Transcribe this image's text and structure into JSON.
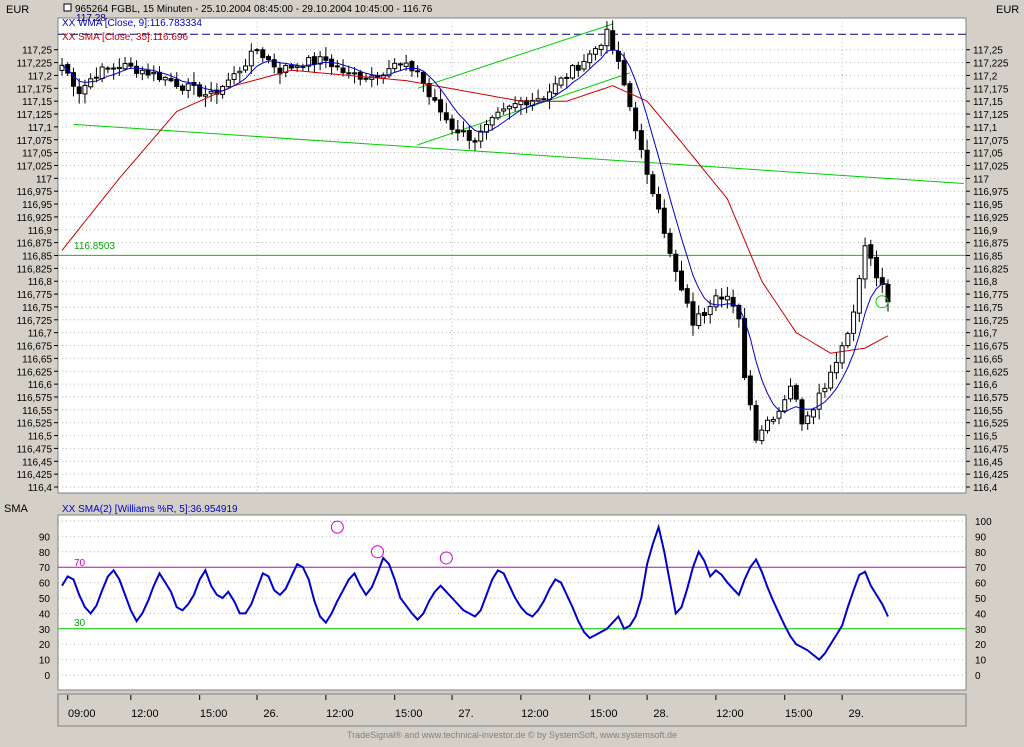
{
  "colors": {
    "background": "#d4d0c8",
    "plot_bg": "#ffffff",
    "candles": "#000000",
    "wma": "#0000cc",
    "sma": "#cc0000",
    "trendlines": "#00cc00",
    "williams": "#0000cc",
    "level70": "#cc00cc",
    "level30": "#00cc00",
    "reference_dash": "#000080",
    "circle": "#cc00cc"
  },
  "header": {
    "currency_left": "EUR",
    "currency_right": "EUR",
    "title": "965264  FGBL, 15 Minuten - 25.10.2004 08:45:00 - 29.10.2004 10:45:00 - 116.76",
    "wma_label": "XX WMA [Close, 9]:116.783334",
    "sma_label": "XX SMA [Close, 35]:116.696",
    "ref_level_label": "117.28",
    "hline_label": "116.8503"
  },
  "indicator": {
    "panel_label": "SMA",
    "series_label": "XX SMA(2) [Williams %R, 5]:36.954919",
    "level70_label": "70",
    "level30_label": "30"
  },
  "footer": {
    "credit": "TradeSignal® and www.technical-investor.de © by SystemSoft, www.systemsoft.de"
  },
  "chart_data": [
    {
      "type": "candlestick",
      "title": "965264  FGBL, 15 Minuten - 25.10.2004 08:45:00 - 29.10.2004 10:45:00 - 116.76",
      "ylabel": "EUR",
      "ylim": [
        116.4,
        117.3
      ],
      "yticks": [
        "117,25",
        "117,225",
        "117,2",
        "117,175",
        "117,15",
        "117,125",
        "117,1",
        "117,075",
        "117,05",
        "117,025",
        "117",
        "116,975",
        "116,95",
        "116,925",
        "116,9",
        "116,875",
        "116,85",
        "116,825",
        "116,8",
        "116,775",
        "116,75",
        "116,725",
        "116,7",
        "116,675",
        "116,65",
        "116,625",
        "116,6",
        "116,575",
        "116,55",
        "116,525",
        "116,5",
        "116,475",
        "116,45",
        "116,425",
        "116,4"
      ],
      "xticks": [
        "09:00",
        "12:00",
        "15:00",
        "26.",
        "12:00",
        "15:00",
        "27.",
        "12:00",
        "15:00",
        "28.",
        "12:00",
        "15:00",
        "29."
      ],
      "bars_per_day": 34,
      "bar_count": 145,
      "last_close": 116.76,
      "close_anchors": [
        [
          0,
          117.22
        ],
        [
          3,
          117.17
        ],
        [
          6,
          117.205
        ],
        [
          10,
          117.22
        ],
        [
          14,
          117.21
        ],
        [
          18,
          117.195
        ],
        [
          22,
          117.175
        ],
        [
          26,
          117.16
        ],
        [
          30,
          117.2
        ],
        [
          34,
          117.25
        ],
        [
          38,
          117.21
        ],
        [
          42,
          117.225
        ],
        [
          46,
          117.23
        ],
        [
          50,
          117.2
        ],
        [
          54,
          117.2
        ],
        [
          58,
          117.22
        ],
        [
          62,
          117.21
        ],
        [
          64,
          117.16
        ],
        [
          68,
          117.1
        ],
        [
          72,
          117.075
        ],
        [
          76,
          117.12
        ],
        [
          80,
          117.15
        ],
        [
          84,
          117.16
        ],
        [
          88,
          117.2
        ],
        [
          92,
          117.24
        ],
        [
          95,
          117.28
        ],
        [
          97,
          117.22
        ],
        [
          100,
          117.1
        ],
        [
          102,
          117.0
        ],
        [
          104,
          116.95
        ],
        [
          106,
          116.85
        ],
        [
          108,
          116.78
        ],
        [
          110,
          116.72
        ],
        [
          112,
          116.74
        ],
        [
          114,
          116.78
        ],
        [
          116,
          116.77
        ],
        [
          118,
          116.72
        ],
        [
          119,
          116.62
        ],
        [
          121,
          116.5
        ],
        [
          123,
          116.53
        ],
        [
          125,
          116.55
        ],
        [
          127,
          116.6
        ],
        [
          129,
          116.53
        ],
        [
          131,
          116.56
        ],
        [
          133,
          116.6
        ],
        [
          135,
          116.65
        ],
        [
          137,
          116.7
        ],
        [
          139,
          116.8
        ],
        [
          140,
          116.87
        ],
        [
          142,
          116.81
        ],
        [
          144,
          116.76
        ]
      ],
      "series": [
        {
          "name": "XX WMA [Close, 9]",
          "last_value": 116.783334,
          "color": "#0000cc"
        },
        {
          "name": "XX SMA [Close, 35]",
          "last_value": 116.696,
          "color": "#cc0000"
        }
      ],
      "sma_anchors": [
        [
          0,
          116.86
        ],
        [
          10,
          117.0
        ],
        [
          20,
          117.13
        ],
        [
          30,
          117.18
        ],
        [
          40,
          117.21
        ],
        [
          50,
          117.2
        ],
        [
          60,
          117.19
        ],
        [
          70,
          117.17
        ],
        [
          80,
          117.15
        ],
        [
          88,
          117.15
        ],
        [
          96,
          117.18
        ],
        [
          102,
          117.15
        ],
        [
          108,
          117.07
        ],
        [
          116,
          116.96
        ],
        [
          122,
          116.8
        ],
        [
          128,
          116.7
        ],
        [
          134,
          116.66
        ],
        [
          140,
          116.67
        ],
        [
          145,
          116.7
        ]
      ],
      "reference_level": 117.28,
      "horizontal_line": 116.8503,
      "trendlines": [
        {
          "from": [
            2,
            117.105
          ],
          "to": [
            145,
            116.99
          ]
        },
        {
          "from": [
            62,
            117.065
          ],
          "to": [
            99,
            117.205
          ]
        },
        {
          "from": [
            62,
            117.175
          ],
          "to": [
            96,
            117.3
          ]
        }
      ]
    },
    {
      "type": "line",
      "title": "XX SMA(2) [Williams %R, 5]:36.954919",
      "ylim": [
        0,
        100
      ],
      "yticks": [
        0,
        10,
        20,
        30,
        40,
        50,
        60,
        70,
        80,
        90,
        100
      ],
      "levels": [
        70,
        30
      ],
      "last_value": 36.954919,
      "values": [
        58,
        64,
        62,
        52,
        44,
        40,
        45,
        55,
        64,
        68,
        62,
        52,
        42,
        35,
        40,
        48,
        58,
        66,
        60,
        54,
        44,
        42,
        46,
        52,
        62,
        68,
        58,
        52,
        50,
        54,
        48,
        40,
        40,
        46,
        56,
        66,
        64,
        55,
        52,
        56,
        64,
        72,
        70,
        62,
        48,
        38,
        34,
        40,
        48,
        55,
        62,
        66,
        58,
        52,
        57,
        66,
        76,
        72,
        62,
        50,
        45,
        40,
        36,
        40,
        48,
        54,
        58,
        54,
        50,
        46,
        42,
        40,
        38,
        42,
        52,
        62,
        68,
        66,
        58,
        50,
        44,
        40,
        38,
        42,
        48,
        56,
        62,
        60,
        52,
        44,
        35,
        28,
        24,
        26,
        28,
        30,
        34,
        38,
        30,
        32,
        38,
        50,
        72,
        85,
        96,
        80,
        60,
        40,
        44,
        56,
        70,
        80,
        74,
        64,
        68,
        65,
        60,
        56,
        52,
        62,
        70,
        75,
        67,
        57,
        48,
        40,
        32,
        25,
        20,
        18,
        16,
        13,
        10,
        14,
        20,
        26,
        32,
        44,
        55,
        65,
        67,
        58,
        52,
        46,
        38
      ],
      "circles": [
        [
          48,
          96
        ],
        [
          55,
          80
        ],
        [
          67,
          76
        ]
      ]
    }
  ]
}
